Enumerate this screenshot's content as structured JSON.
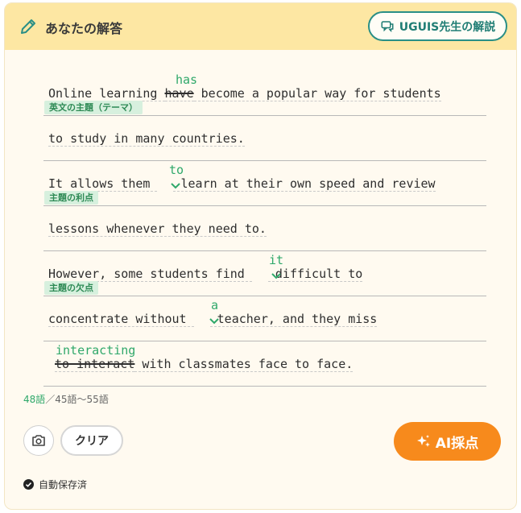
{
  "header": {
    "title": "あなたの解答",
    "explain_label": "UGUIS先生の解説"
  },
  "essay": {
    "row1": {
      "before": "Online learning ",
      "struck": "have",
      "after": " become a popular way for students",
      "insert": "has",
      "tag": "英文の主題（テーマ）"
    },
    "row2": {
      "text": "to study in many countries."
    },
    "row3": {
      "before": "It allows them ",
      "after": " learn at their own speed and review",
      "insert": "to",
      "tag": "主題の利点"
    },
    "row4": {
      "text": "lessons whenever they need to."
    },
    "row5": {
      "before": "However, some students find ",
      "after": " difficult to",
      "insert": "it",
      "tag": "主題の欠点"
    },
    "row6": {
      "before": "concentrate without ",
      "after": " teacher, and they miss",
      "insert": "a"
    },
    "row7": {
      "struck": "to interact",
      "after": " with classmates face to face.",
      "insert": "interacting"
    }
  },
  "word_count": {
    "current": "48語",
    "range": "／45語〜55語"
  },
  "buttons": {
    "clear": "クリア",
    "ai_score": "AI採点"
  },
  "status": {
    "saved": "自動保存済"
  },
  "colors": {
    "header_bg": "#fde7a3",
    "accent_teal": "#2a8f86",
    "insert_green": "#2fa86a",
    "ai_orange": "#f78a1c"
  }
}
